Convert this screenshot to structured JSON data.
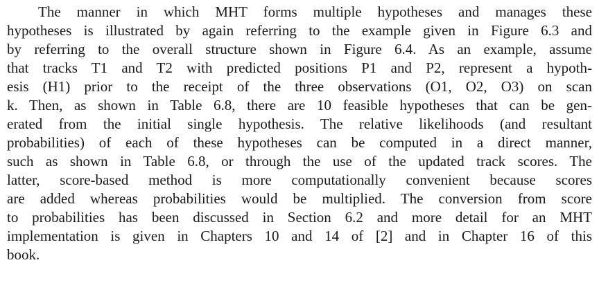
{
  "paragraph": {
    "lines": [
      "The manner in which MHT forms multiple hypotheses and manages these",
      "hypotheses is illustrated by again referring to the example given in Figure 6.3 and",
      "by referring to the overall structure shown in Figure 6.4. As an example, assume",
      "that tracks T1 and T2 with predicted positions P1 and P2, represent a hypoth-",
      "esis (H1) prior to the receipt of the three observations (O1, O2, O3) on scan",
      "k. Then, as shown in Table 6.8, there are 10 feasible hypotheses that can be gen-",
      "erated from the initial single hypothesis. The relative likelihoods (and resultant",
      "probabilities) of each of these hypotheses can be computed in a direct manner,",
      "such as shown in Table 6.8, or through the use of the updated track scores. The",
      "latter, score-based method is more computationally convenient because scores",
      "are added whereas probabilities would be multiplied. The conversion from score",
      "to probabilities has been discussed in Section 6.2 and more detail for an MHT",
      "implementation is given in Chapters 10 and 14 of [2] and in Chapter 16 of this",
      "book."
    ]
  }
}
